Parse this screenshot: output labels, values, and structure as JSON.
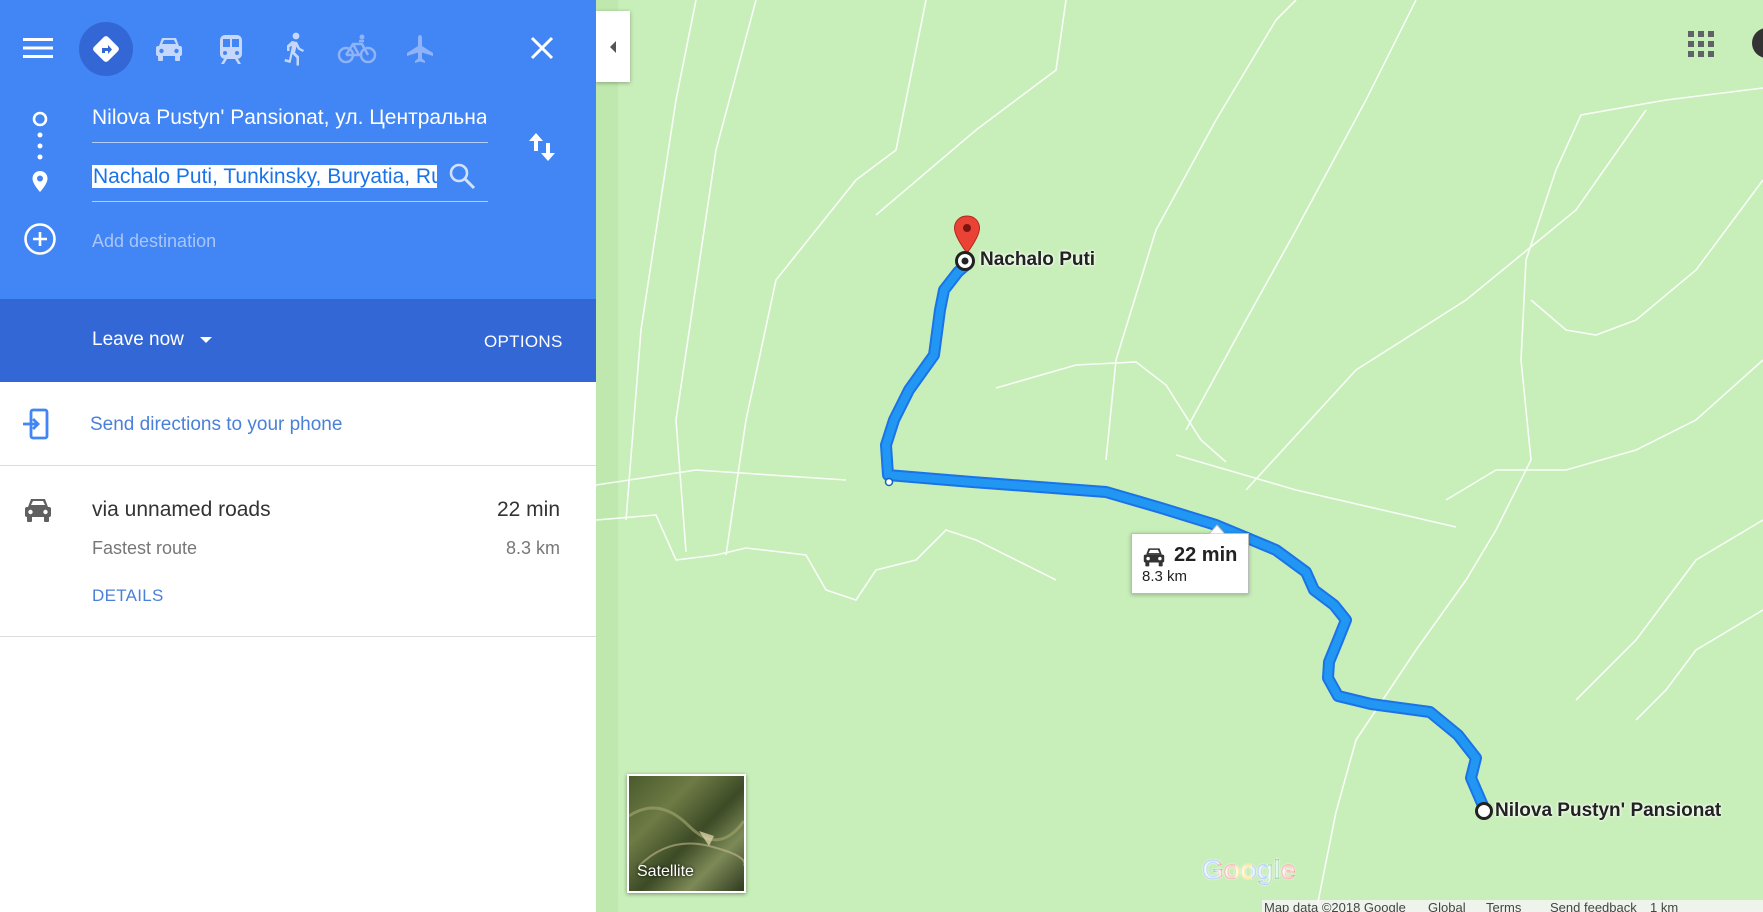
{
  "directions": {
    "origin": {
      "value": "Nilova Pustyn' Pansionat, ул. Центральная"
    },
    "destination": {
      "value": "Nachalo Puti, Tunkinsky, Buryatia, Russia"
    },
    "add_destination_placeholder": "Add destination",
    "travel_modes": [
      "best-route",
      "driving",
      "transit",
      "walking",
      "cycling",
      "flights"
    ],
    "active_mode": "best-route"
  },
  "leave": {
    "label": "Leave now",
    "options_label": "OPTIONS"
  },
  "send_to_phone": {
    "label": "Send directions to your phone"
  },
  "route": {
    "via": "via unnamed roads",
    "duration": "22 min",
    "subtitle": "Fastest route",
    "distance": "8.3 km",
    "details_label": "DETAILS"
  },
  "map": {
    "destination_label": "Nachalo Puti",
    "origin_label": "Nilova Pustyn' Pansionat",
    "route_bubble": {
      "duration": "22 min",
      "distance": "8.3 km"
    },
    "satellite_label": "Satellite",
    "logo": "Google",
    "footer": {
      "map_data": "Map data ©2018 Google",
      "global": "Global",
      "terms": "Terms",
      "feedback": "Send feedback",
      "scale": "1 km"
    },
    "colors": {
      "land": "#c8eeb9",
      "route": "#2196f3",
      "pin": "#ea4335"
    }
  }
}
